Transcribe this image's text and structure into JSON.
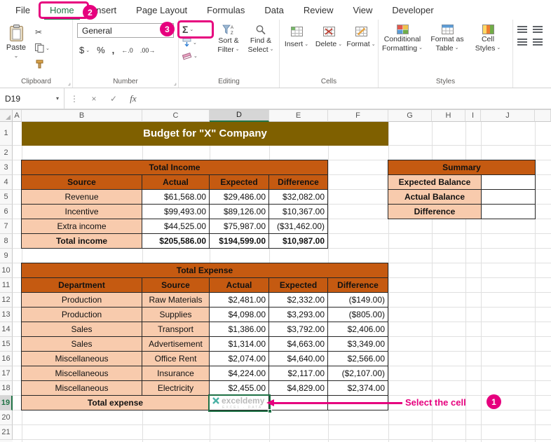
{
  "colors": {
    "annotation_pink": "#E6007E",
    "excel_green": "#217346",
    "table_header_orange": "#C55A11",
    "table_cell_peach": "#F8CBAD",
    "title_banner_gold": "#7F6000"
  },
  "tabs": {
    "items": [
      "File",
      "Home",
      "Insert",
      "Page Layout",
      "Formulas",
      "Data",
      "Review",
      "View",
      "Developer"
    ],
    "selected": "Home"
  },
  "ribbon": {
    "clipboard": {
      "paste_label": "Paste",
      "group_label": "Clipboard"
    },
    "number": {
      "format_value": "General",
      "currency_label": "$",
      "percent_label": "%",
      "comma_label": ",",
      "increase_decimal": "←.0",
      "decrease_decimal": ".00→",
      "group_label": "Number"
    },
    "editing": {
      "autosum_label": "Σ",
      "sort_filter_line1": "Sort &",
      "sort_filter_line2": "Filter",
      "find_select_line1": "Find &",
      "find_select_line2": "Select",
      "group_label": "Editing"
    },
    "cells": {
      "insert_label": "Insert",
      "delete_label": "Delete",
      "format_label": "Format",
      "group_label": "Cells"
    },
    "styles": {
      "conditional_line1": "Conditional",
      "conditional_line2": "Formatting",
      "format_table_line1": "Format as",
      "format_table_line2": "Table",
      "cell_styles_line1": "Cell",
      "cell_styles_line2": "Styles",
      "group_label": "Styles"
    }
  },
  "formula_bar": {
    "name_box_value": "D19",
    "fx_label": "fx"
  },
  "grid": {
    "columns": [
      "A",
      "B",
      "C",
      "D",
      "E",
      "F",
      "G",
      "H",
      "I",
      "J"
    ],
    "rows": [
      "1",
      "2",
      "3",
      "4",
      "5",
      "6",
      "7",
      "8",
      "9",
      "10",
      "11",
      "12",
      "13",
      "14",
      "15",
      "16",
      "17",
      "18",
      "19",
      "20",
      "21"
    ],
    "selected_cell": "D19",
    "selected_column": "D",
    "selected_row": "19"
  },
  "sheet": {
    "title": "Budget for \"X\" Company",
    "income_table": {
      "title": "Total Income",
      "headers": [
        "Source",
        "Actual",
        "Expected",
        "Difference"
      ],
      "rows": [
        [
          "Revenue",
          "$61,568.00",
          "$29,486.00",
          "$32,082.00"
        ],
        [
          "Incentive",
          "$99,493.00",
          "$89,126.00",
          "$10,367.00"
        ],
        [
          "Extra income",
          "$44,525.00",
          "$75,987.00",
          "($31,462.00)"
        ]
      ],
      "total_row": [
        "Total income",
        "$205,586.00",
        "$194,599.00",
        "$10,987.00"
      ]
    },
    "summary_table": {
      "title": "Summary",
      "row_labels": [
        "Expected Balance",
        "Actual Balance",
        "Difference"
      ]
    },
    "expense_table": {
      "title": "Total Expense",
      "headers": [
        "Department",
        "Source",
        "Actual",
        "Expected",
        "Difference"
      ],
      "rows": [
        [
          "Production",
          "Raw Materials",
          "$2,481.00",
          "$2,332.00",
          "($149.00)"
        ],
        [
          "Production",
          "Supplies",
          "$4,098.00",
          "$3,293.00",
          "($805.00)"
        ],
        [
          "Sales",
          "Transport",
          "$1,386.00",
          "$3,792.00",
          "$2,406.00"
        ],
        [
          "Sales",
          "Advertisement",
          "$1,314.00",
          "$4,663.00",
          "$3,349.00"
        ],
        [
          "Miscellaneous",
          "Office Rent",
          "$2,074.00",
          "$4,640.00",
          "$2,566.00"
        ],
        [
          "Miscellaneous",
          "Insurance",
          "$4,224.00",
          "$2,117.00",
          "($2,107.00)"
        ],
        [
          "Miscellaneous",
          "Electricity",
          "$2,455.00",
          "$4,829.00",
          "$2,374.00"
        ]
      ],
      "total_label": "Total expense"
    },
    "watermark": {
      "brand": "exceldemy",
      "tagline": "EXCEL · DATA"
    }
  },
  "annotations": {
    "select_cell_label": "Select the cell",
    "step1_badge": "1",
    "step2_badge": "2",
    "step3_badge": "3"
  }
}
